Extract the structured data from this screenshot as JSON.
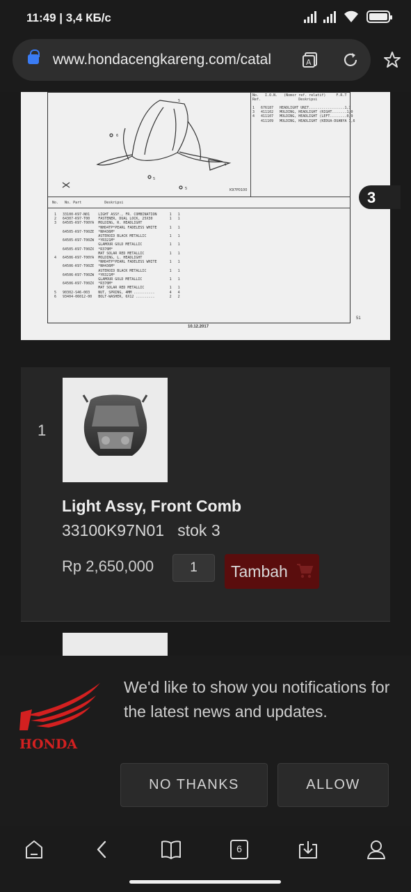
{
  "status_bar": {
    "time_speed": "11:49 | 3,4 КБ/с"
  },
  "browser": {
    "url": "www.hondacengkareng.com/catal"
  },
  "diagram": {
    "section_tab": "3",
    "date": "10.12.2017",
    "page": "51",
    "table_header": "No.   No. Part           Deskripsi",
    "right_header": "No.   I.O.N.   (Nomor ref. relatif)     F.R.T\nRef.                  Deskripsi",
    "right_rows": "1   676187   HEADLIGHT UNIT.................1,7\n3   411102   MOLDING, HEADLIGHT (RIGHT.......1,0\n4   411107   MOLDING, HEADLIGHT (LEFT........0,9\n    411109   MOLDING, HEADLIGHT (KEDUA-DUANYA 1,6",
    "parts_rows": "1   33100-K97-N01    LIGHT ASSY., FR. COMBINATION      1   1\n2   64307-K97-T00    FASTENER, DUAL LOCK, 25X30        1   1\n3   64505-K97-T00YA  MOLDING, R. HEADLIGHT\n                     *NHD4TP*PEARL FADELESS WHITE      1   1\n    64505-K97-T00ZE  *NH436M*\n                     ASTEROID BLACK METALLIC           1   1\n    64505-K97-T00ZW  *YR321M*\n                     GLAMOUR GOLD METALLIC             1   1\n    64505-K97-T00ZX  *R370M*\n                     MAT SOLAR RED METALLIC            1   1\n4   64506-K97-T00YA  MOLDING, L. HEADLIGHT\n                     *NHD4TP*PEARL FADELESS WHITE      1   1\n    64506-K97-T00ZE  *NH436M*\n                     ASTEROID BLACK METALLIC           1   1\n    64506-K97-T00ZW  *YR321M*\n                     GLAMOUR GOLD METALLIC             1   1\n    64506-K97-T00ZX  *R370M*\n                     MAT SOLAR RED METALLIC            1   1\n5   90302-S46-003    NUT, SPRING, 4MM ..........       4   4\n6   93404-06012-00   BOLT-WASHER, 6X12 .........       2   2"
  },
  "product": {
    "row_number": "1",
    "name": "Light Assy, Front Comb",
    "code_stock": "33100K97N01   stok 3",
    "price": "Rp 2,650,000",
    "quantity": "1",
    "add_label": "Tambah"
  },
  "notification": {
    "message": "We'd like to show you notifications for the latest news and updates.",
    "no_thanks": "NO THANKS",
    "allow": "ALLOW",
    "logo_text": "HONDA"
  },
  "bottom_nav": {
    "tabs_count": "6"
  },
  "colors": {
    "accent_lock": "#3a7cf5",
    "add_button": "#5a0d0d",
    "honda_red": "#d32020"
  }
}
